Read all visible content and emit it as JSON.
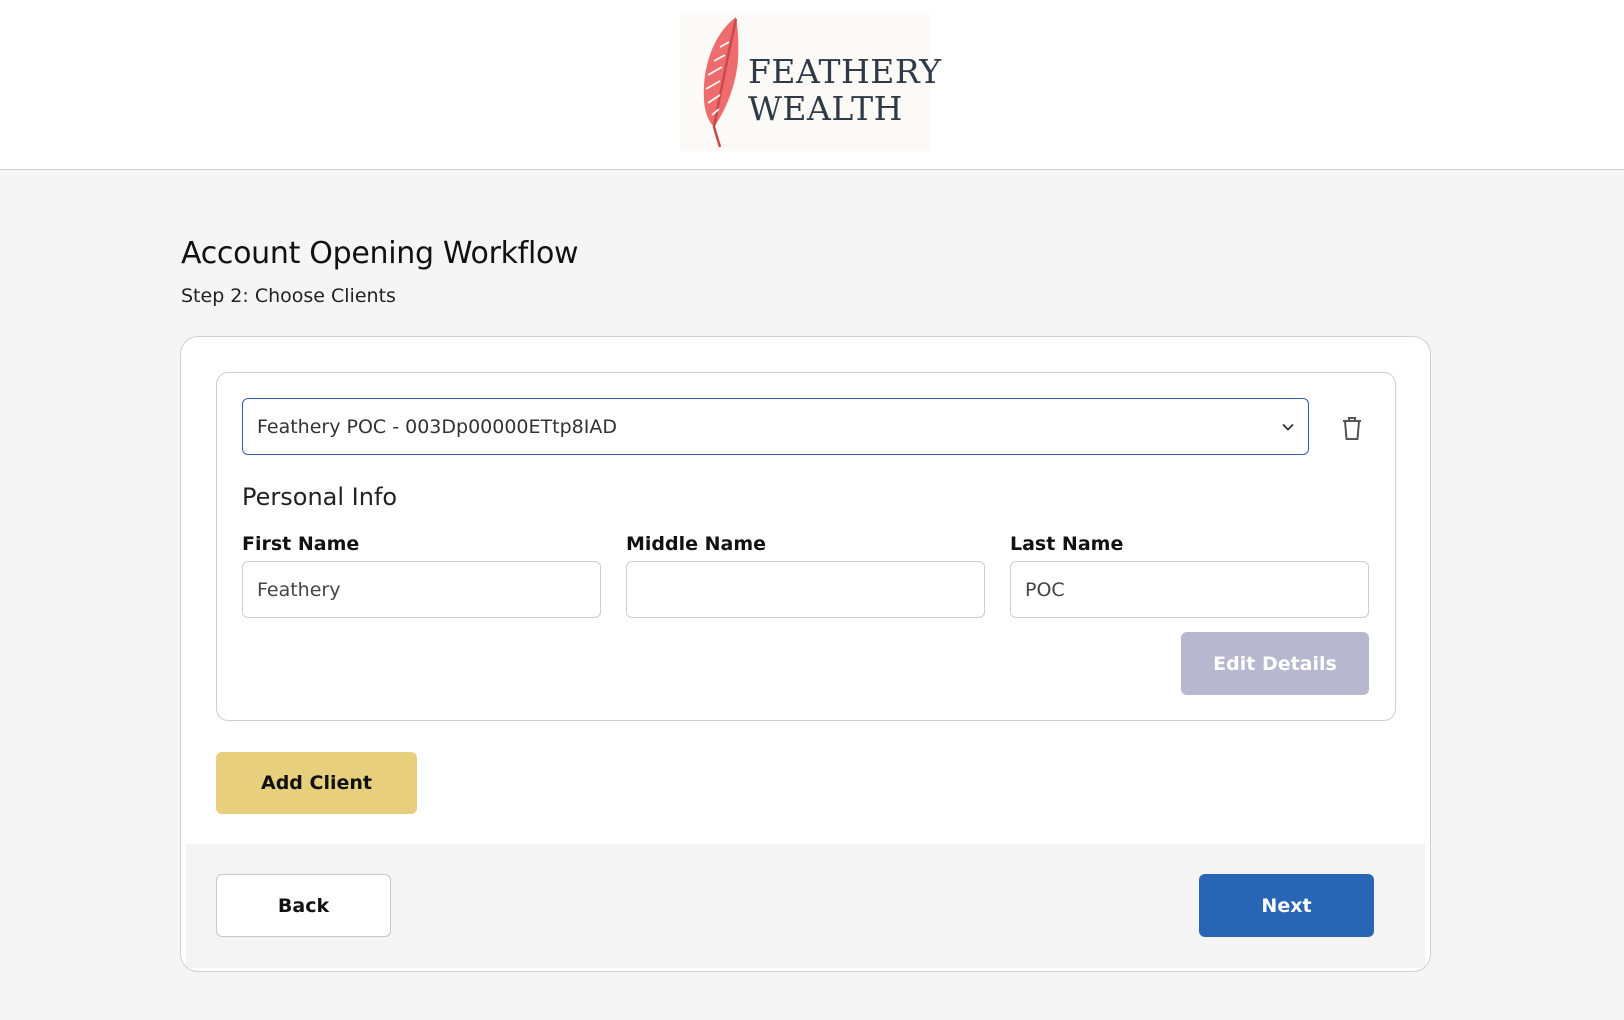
{
  "header": {
    "logo_line1": "FEATHERY",
    "logo_line2": "WEALTH",
    "logo_icon": "feather-icon",
    "logo_icon_color": "#ee6c6e"
  },
  "page": {
    "title": "Account Opening Workflow",
    "subtitle": "Step 2: Choose Clients"
  },
  "client": {
    "selected_client": "Feathery POC - 003Dp00000ETtp8IAD",
    "delete_icon": "trash-icon",
    "section_title": "Personal Info",
    "first_name_label": "First Name",
    "first_name_value": "Feathery",
    "middle_name_label": "Middle Name",
    "middle_name_value": "",
    "last_name_label": "Last Name",
    "last_name_value": "POC",
    "edit_label": "Edit Details"
  },
  "actions": {
    "add_client_label": "Add Client",
    "back_label": "Back",
    "next_label": "Next"
  },
  "colors": {
    "accent_blue": "#2965b5",
    "add_client_yellow": "#e7cf7e",
    "disabled_button": "#b7b7cf"
  }
}
